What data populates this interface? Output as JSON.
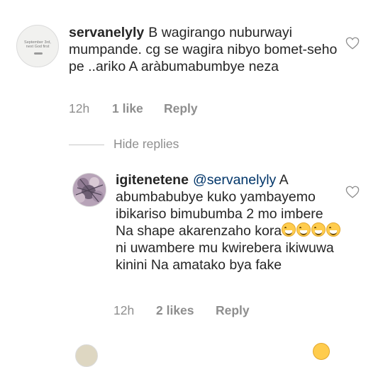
{
  "comments": [
    {
      "username": "servanelyly",
      "text": "B wagirango nuburwayi mumpande. cg se wagira nibyo bomet-seho pe ..ariko A aràbumabumbye neza",
      "time": "12h",
      "likes": "1 like",
      "reply_label": "Reply",
      "avatar_text": "September 3rd, next God first"
    },
    {
      "username": "igitenetene",
      "mention": "@servanelyly",
      "text_before_emoji": "A abumbabubye kuko yambayemo ibikariso bimubumba 2 mo imbere Na shape akarenzaho kora",
      "emoji": [
        "grinning-face-with-smiling-eyes",
        "grinning-face-with-smiling-eyes",
        "grinning-face-with-smiling-eyes",
        "grinning-face-with-smiling-eyes"
      ],
      "text_after_emoji": "ni uwambere mu kwirebera ikiwuwa kinini Na amatako bya fake",
      "time": "12h",
      "likes": "2 likes",
      "reply_label": "Reply"
    }
  ],
  "hide_replies_label": "Hide replies",
  "icons": {
    "like": "heart-outline-icon"
  },
  "colors": {
    "text": "#262626",
    "meta": "#8e8e8e",
    "mention": "#003569",
    "divider": "#c7c7c7"
  }
}
